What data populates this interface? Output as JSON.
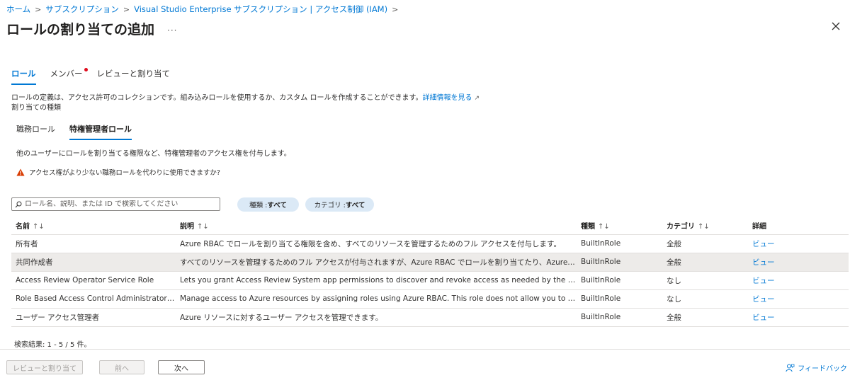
{
  "breadcrumb": [
    "ホーム",
    "サブスクリプション",
    "Visual Studio Enterprise サブスクリプション | アクセス制御 (IAM)"
  ],
  "title": "ロールの割り当ての追加",
  "more": "···",
  "tabs": [
    "ロール",
    "メンバー",
    "レビューと割り当て"
  ],
  "description": {
    "text": "ロールの定義は、アクセス許可のコレクションです。組み込みロールを使用するか、カスタム ロールを作成することができます。",
    "link": "詳細情報を見る"
  },
  "assignment_type_label": "割り当ての種類",
  "subtabs": [
    "職務ロール",
    "特権管理者ロール"
  ],
  "subtab_description": "他のユーザーにロールを割り当てる権限など、特権管理者のアクセス権を付与します。",
  "warning": "アクセス権がより少ない職務ロールを代わりに使用できますか?",
  "search": {
    "placeholder": "ロール名、説明、または ID で検索してください",
    "value": ""
  },
  "filters": {
    "type": {
      "label": "種類 : ",
      "value": "すべて"
    },
    "category": {
      "label": "カテゴリ : ",
      "value": "すべて"
    }
  },
  "sort_glyph": "↑↓",
  "table": {
    "headers": [
      "名前",
      "説明",
      "種類",
      "カテゴリ",
      "詳細"
    ],
    "rows": [
      {
        "name": "所有者",
        "description": "Azure RBAC でロールを割り当てる権限を含め、すべてのリソースを管理するためのフル アクセスを付与します。",
        "type": "BuiltInRole",
        "category": "全般",
        "detail": "ビュー"
      },
      {
        "name": "共同作成者",
        "description": "すべてのリソースを管理するためのフル アクセスが付与されますが、Azure RBAC でロールを割り当てたり、Azure Blueprints で割り当てを管理したり、イメージ ギャラリーを共有したりすることはできません。",
        "type": "BuiltInRole",
        "category": "全般",
        "detail": "ビュー"
      },
      {
        "name": "Access Review Operator Service Role",
        "description": "Lets you grant Access Review System app permissions to discover and revoke access as needed by the access review process.",
        "type": "BuiltInRole",
        "category": "なし",
        "detail": "ビュー"
      },
      {
        "name": "Role Based Access Control Administrator (Preview)",
        "description": "Manage access to Azure resources by assigning roles using Azure RBAC. This role does not allow you to manage access using other ways, such as Azure Policy.",
        "type": "BuiltInRole",
        "category": "なし",
        "detail": "ビュー"
      },
      {
        "name": "ユーザー アクセス管理者",
        "description": "Azure リソースに対するユーザー アクセスを管理できます。",
        "type": "BuiltInRole",
        "category": "全般",
        "detail": "ビュー"
      }
    ]
  },
  "result_count": "検索結果: 1 - 5 / 5 件。",
  "buttons": {
    "review": "レビューと割り当て",
    "prev": "前へ",
    "next": "次へ"
  },
  "feedback": "フィードバック",
  "colors": {
    "accent": "#0078d4",
    "warning": "#d83b01",
    "notification": "#e00b1c",
    "pill": "#dbe9f6",
    "selected_row": "#edebe9"
  }
}
